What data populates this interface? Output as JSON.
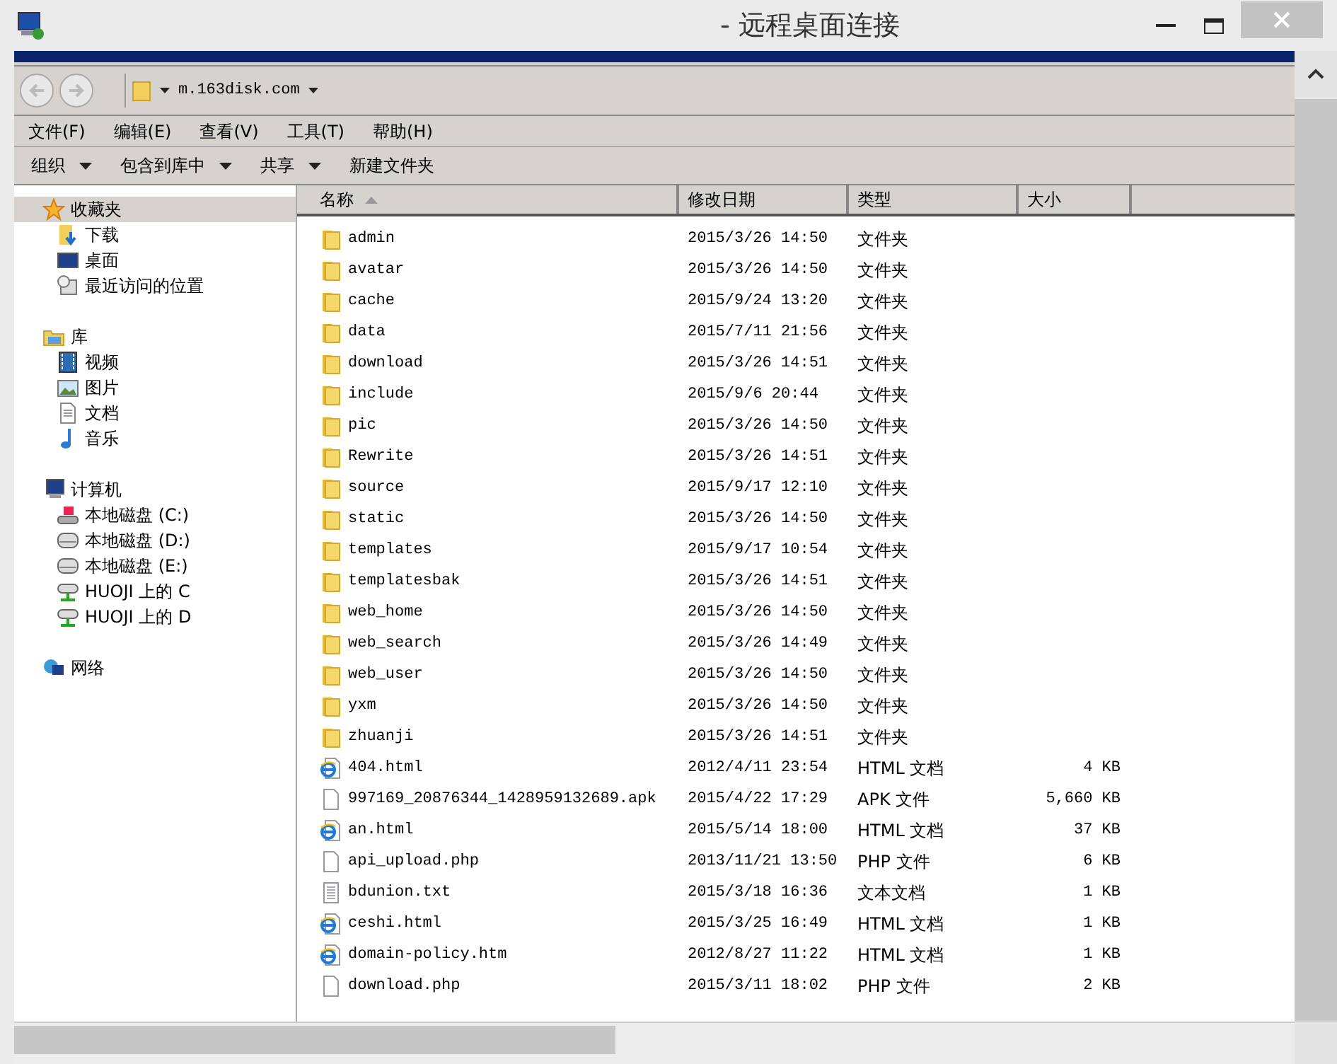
{
  "window": {
    "title": "- 远程桌面连接"
  },
  "address": {
    "path": "m.163disk.com"
  },
  "menu": [
    "文件(F)",
    "编辑(E)",
    "查看(V)",
    "工具(T)",
    "帮助(H)"
  ],
  "toolbar": [
    {
      "label": "组织",
      "dropdown": true
    },
    {
      "label": "包含到库中",
      "dropdown": true
    },
    {
      "label": "共享",
      "dropdown": true
    },
    {
      "label": "新建文件夹",
      "dropdown": false
    }
  ],
  "nav": [
    {
      "label": "收藏夹",
      "kind": "star",
      "selected": true,
      "children": [
        {
          "label": "下载",
          "kind": "download"
        },
        {
          "label": "桌面",
          "kind": "desktop"
        },
        {
          "label": "最近访问的位置",
          "kind": "recent"
        }
      ]
    },
    {
      "label": "库",
      "kind": "library",
      "selected": false,
      "children": [
        {
          "label": "视频",
          "kind": "video"
        },
        {
          "label": "图片",
          "kind": "picture"
        },
        {
          "label": "文档",
          "kind": "document"
        },
        {
          "label": "音乐",
          "kind": "music"
        }
      ]
    },
    {
      "label": "计算机",
      "kind": "computer",
      "selected": false,
      "children": [
        {
          "label": "本地磁盘 (C:)",
          "kind": "system-drive"
        },
        {
          "label": "本地磁盘 (D:)",
          "kind": "drive"
        },
        {
          "label": "本地磁盘 (E:)",
          "kind": "drive"
        },
        {
          "label": "HUOJI 上的 C",
          "kind": "network-drive"
        },
        {
          "label": "HUOJI 上的 D",
          "kind": "network-drive"
        }
      ]
    },
    {
      "label": "网络",
      "kind": "network",
      "selected": false
    }
  ],
  "table": {
    "columns": [
      {
        "label": "名称",
        "sorted": true
      },
      {
        "label": "修改日期",
        "sorted": false
      },
      {
        "label": "类型",
        "sorted": false
      },
      {
        "label": "大小",
        "sorted": false
      }
    ],
    "rows": [
      {
        "kind": "folder",
        "name": "admin",
        "date": "2015/3/26 14:50",
        "type": "文件夹"
      },
      {
        "kind": "folder",
        "name": "avatar",
        "date": "2015/3/26 14:50",
        "type": "文件夹"
      },
      {
        "kind": "folder",
        "name": "cache",
        "date": "2015/9/24 13:20",
        "type": "文件夹"
      },
      {
        "kind": "folder",
        "name": "data",
        "date": "2015/7/11 21:56",
        "type": "文件夹"
      },
      {
        "kind": "folder",
        "name": "download",
        "date": "2015/3/26 14:51",
        "type": "文件夹"
      },
      {
        "kind": "folder",
        "name": "include",
        "date": "2015/9/6 20:44",
        "type": "文件夹"
      },
      {
        "kind": "folder",
        "name": "pic",
        "date": "2015/3/26 14:50",
        "type": "文件夹"
      },
      {
        "kind": "folder",
        "name": "Rewrite",
        "date": "2015/3/26 14:51",
        "type": "文件夹"
      },
      {
        "kind": "folder",
        "name": "source",
        "date": "2015/9/17 12:10",
        "type": "文件夹"
      },
      {
        "kind": "folder",
        "name": "static",
        "date": "2015/3/26 14:50",
        "type": "文件夹"
      },
      {
        "kind": "folder",
        "name": "templates",
        "date": "2015/9/17 10:54",
        "type": "文件夹"
      },
      {
        "kind": "folder",
        "name": "templatesbak",
        "date": "2015/3/26 14:51",
        "type": "文件夹"
      },
      {
        "kind": "folder",
        "name": "web_home",
        "date": "2015/3/26 14:50",
        "type": "文件夹"
      },
      {
        "kind": "folder",
        "name": "web_search",
        "date": "2015/3/26 14:49",
        "type": "文件夹"
      },
      {
        "kind": "folder",
        "name": "web_user",
        "date": "2015/3/26 14:50",
        "type": "文件夹"
      },
      {
        "kind": "folder",
        "name": "yxm",
        "date": "2015/3/26 14:50",
        "type": "文件夹"
      },
      {
        "kind": "folder",
        "name": "zhuanji",
        "date": "2015/3/26 14:51",
        "type": "文件夹"
      },
      {
        "kind": "html",
        "name": "404.html",
        "date": "2012/4/11 23:54",
        "type": "HTML 文档",
        "size": "4 KB"
      },
      {
        "kind": "file",
        "name": "997169_20876344_1428959132689.apk",
        "date": "2015/4/22 17:29",
        "type": "APK 文件",
        "size": "5,660 KB"
      },
      {
        "kind": "html",
        "name": "an.html",
        "date": "2015/5/14 18:00",
        "type": "HTML 文档",
        "size": "37 KB"
      },
      {
        "kind": "file",
        "name": "api_upload.php",
        "date": "2013/11/21 13:50",
        "type": "PHP 文件",
        "size": "6 KB"
      },
      {
        "kind": "text",
        "name": "bdunion.txt",
        "date": "2015/3/18 16:36",
        "type": "文本文档",
        "size": "1 KB"
      },
      {
        "kind": "html",
        "name": "ceshi.html",
        "date": "2015/3/25 16:49",
        "type": "HTML 文档",
        "size": "1 KB"
      },
      {
        "kind": "html",
        "name": "domain-policy.htm",
        "date": "2012/8/27 11:22",
        "type": "HTML 文档",
        "size": "1 KB"
      },
      {
        "kind": "file",
        "name": "download.php",
        "date": "2015/3/11 18:02",
        "type": "PHP 文件",
        "size": "2 KB"
      }
    ]
  }
}
